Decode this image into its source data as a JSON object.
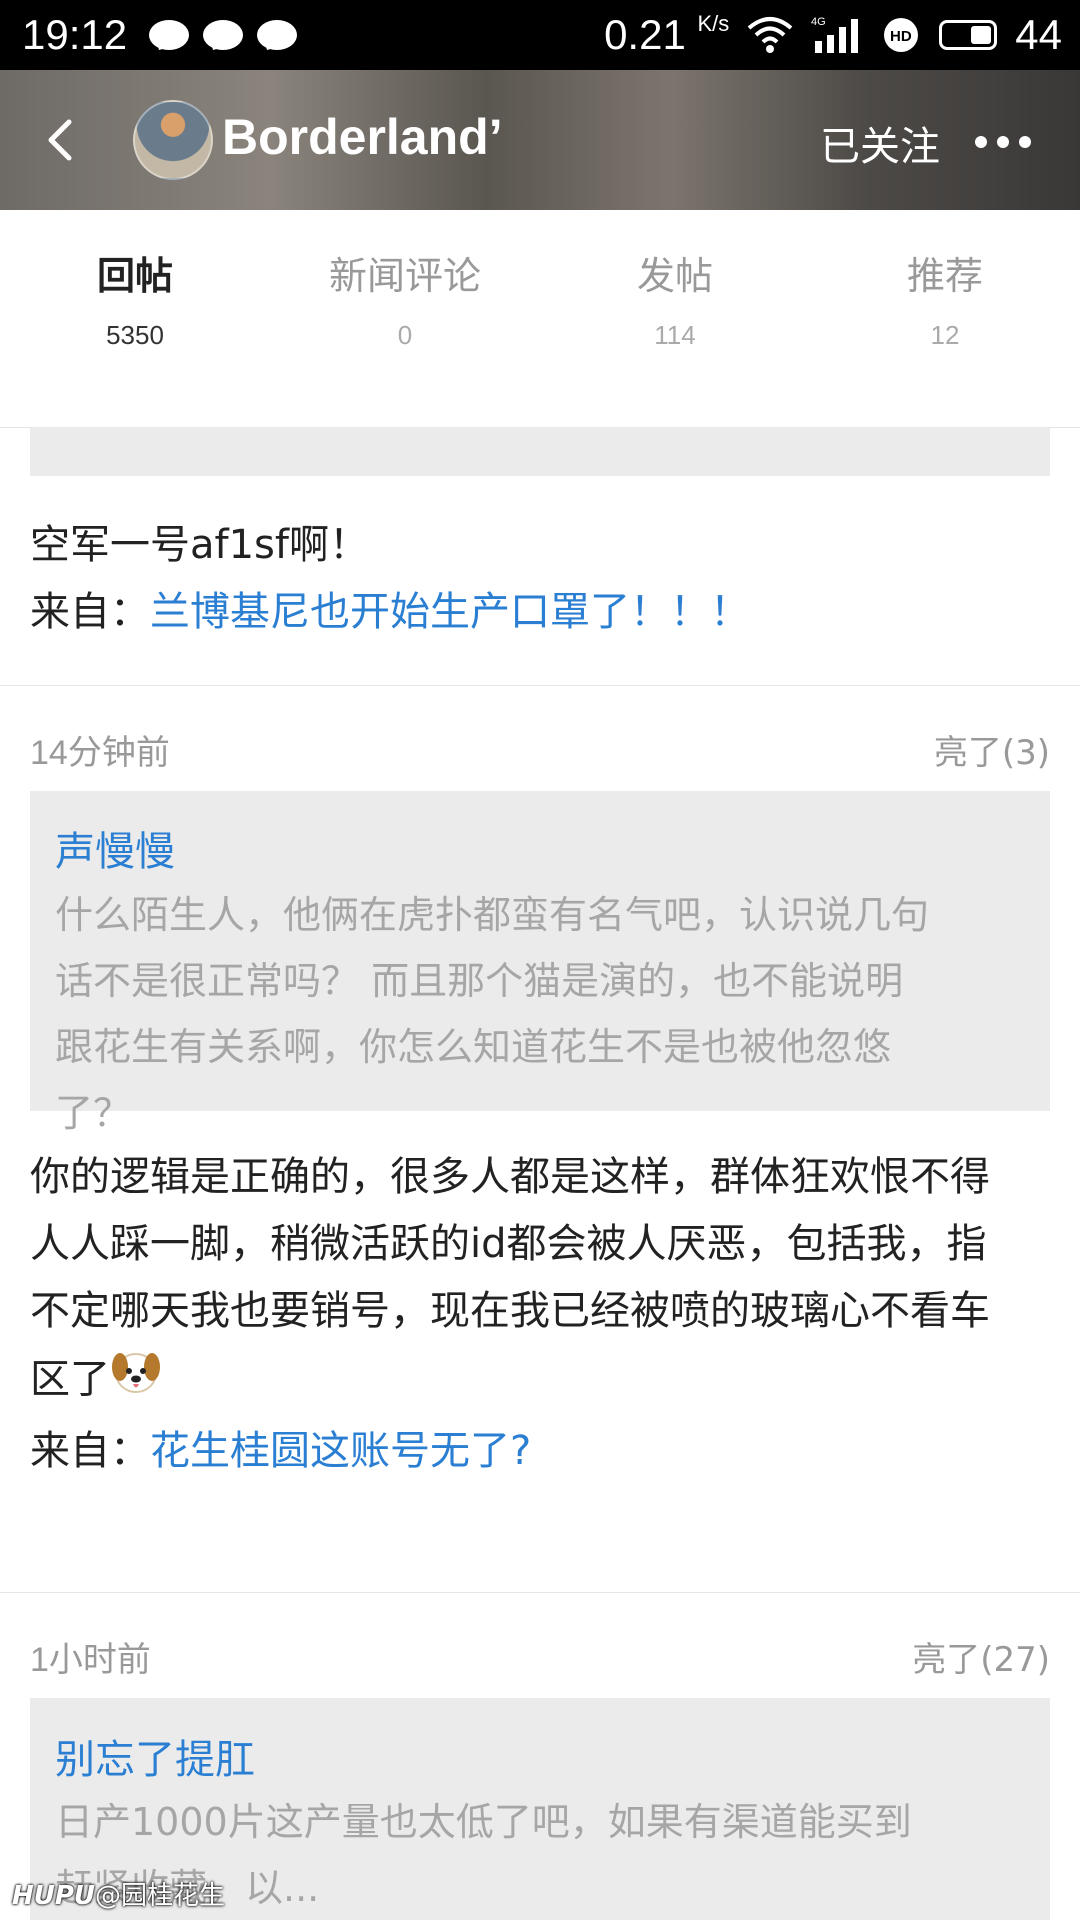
{
  "status_bar": {
    "time": "19:12",
    "speed": "0.21",
    "speed_unit": "K/s",
    "network": "4G",
    "hd": "HD",
    "battery": "44"
  },
  "header": {
    "username": "Borderland’",
    "follow_label": "已关注"
  },
  "tabs": [
    {
      "label": "回帖",
      "count": "5350",
      "active": true
    },
    {
      "label": "新闻评论",
      "count": "0",
      "active": false
    },
    {
      "label": "发帖",
      "count": "114",
      "active": false
    },
    {
      "label": "推荐",
      "count": "12",
      "active": false
    }
  ],
  "posts": [
    {
      "body": "空军一号af1sf啊！",
      "from_prefix": "来自：",
      "from_title": "兰博基尼也开始生产口罩了！！！"
    },
    {
      "time": "14分钟前",
      "likes": "亮了(3)",
      "quote_author": "声慢慢",
      "quote_lines": [
        "什么陌生人，他俩在虎扑都蛮有名气吧，认识说几句",
        "话不是很正常吗？ 而且那个猫是演的，也不能说明",
        "跟花生有关系啊，你怎么知道花生不是也被他忽悠",
        "了？"
      ],
      "body_lines": [
        "你的逻辑是正确的，很多人都是这样，群体狂欢恨不得",
        "人人踩一脚，稍微活跃的id都会被人厌恶，包括我，指",
        "不定哪天我也要销号，现在我已经被喷的玻璃心不看车",
        "区了"
      ],
      "emoji": "dog-face",
      "from_prefix": "来自：",
      "from_title": "花生桂圆这账号无了?"
    },
    {
      "time": "1小时前",
      "likes": "亮了(27)",
      "quote_author": "别忘了提肛",
      "quote_lines": [
        "日产1000片这产量也太低了吧，如果有渠道能买到",
        "赶紧收藏，以..."
      ]
    }
  ],
  "watermark": {
    "brand": "HUPU",
    "handle": "@园桂花生"
  },
  "colors": {
    "link": "#2b7fd3",
    "quote_bg": "#ebebeb",
    "status_bar_bg": "#000000"
  }
}
